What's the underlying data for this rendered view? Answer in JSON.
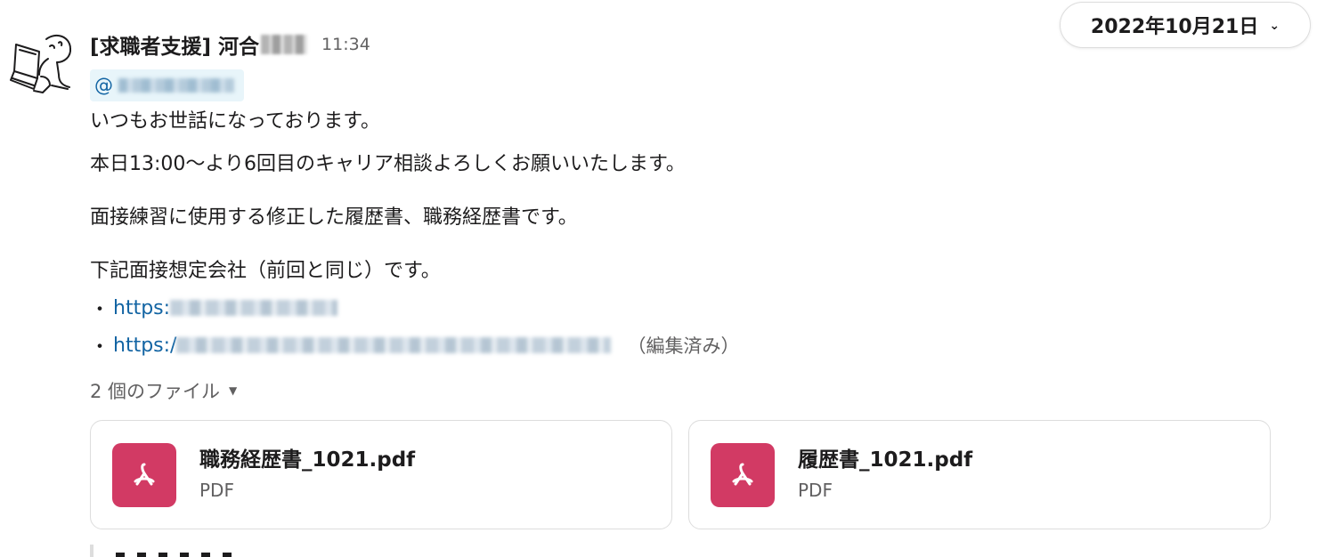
{
  "date_divider": {
    "label": "2022年10月21日",
    "icon": "chevron-down-icon"
  },
  "message": {
    "sender": "[求職者支援] 河合",
    "timestamp": "11:34",
    "mention_prefix": "@",
    "lines": [
      "いつもお世話になっております。",
      "本日13:00〜より6回目のキャリア相談よろしくお願いいたします。",
      "面接練習に使用する修正した履歴書、職務経歴書です。",
      "下記面接想定会社（前回と同じ）です。"
    ],
    "links": [
      {
        "bullet": "・",
        "text": "https:"
      },
      {
        "bullet": "・",
        "text": "https:/"
      }
    ],
    "edited_label": "（編集済み）"
  },
  "files": {
    "toggle_label": "2 個のファイル",
    "toggle_icon": "caret-down-icon",
    "items": [
      {
        "name": "職務経歴書_1021.pdf",
        "type": "PDF",
        "icon": "pdf-icon"
      },
      {
        "name": "履歴書_1021.pdf",
        "type": "PDF",
        "icon": "pdf-icon"
      }
    ]
  },
  "colors": {
    "link": "#1264a3",
    "pdf_icon_bg": "#d23a64",
    "mention_bg": "#e8f5fa",
    "muted_text": "#616061"
  }
}
